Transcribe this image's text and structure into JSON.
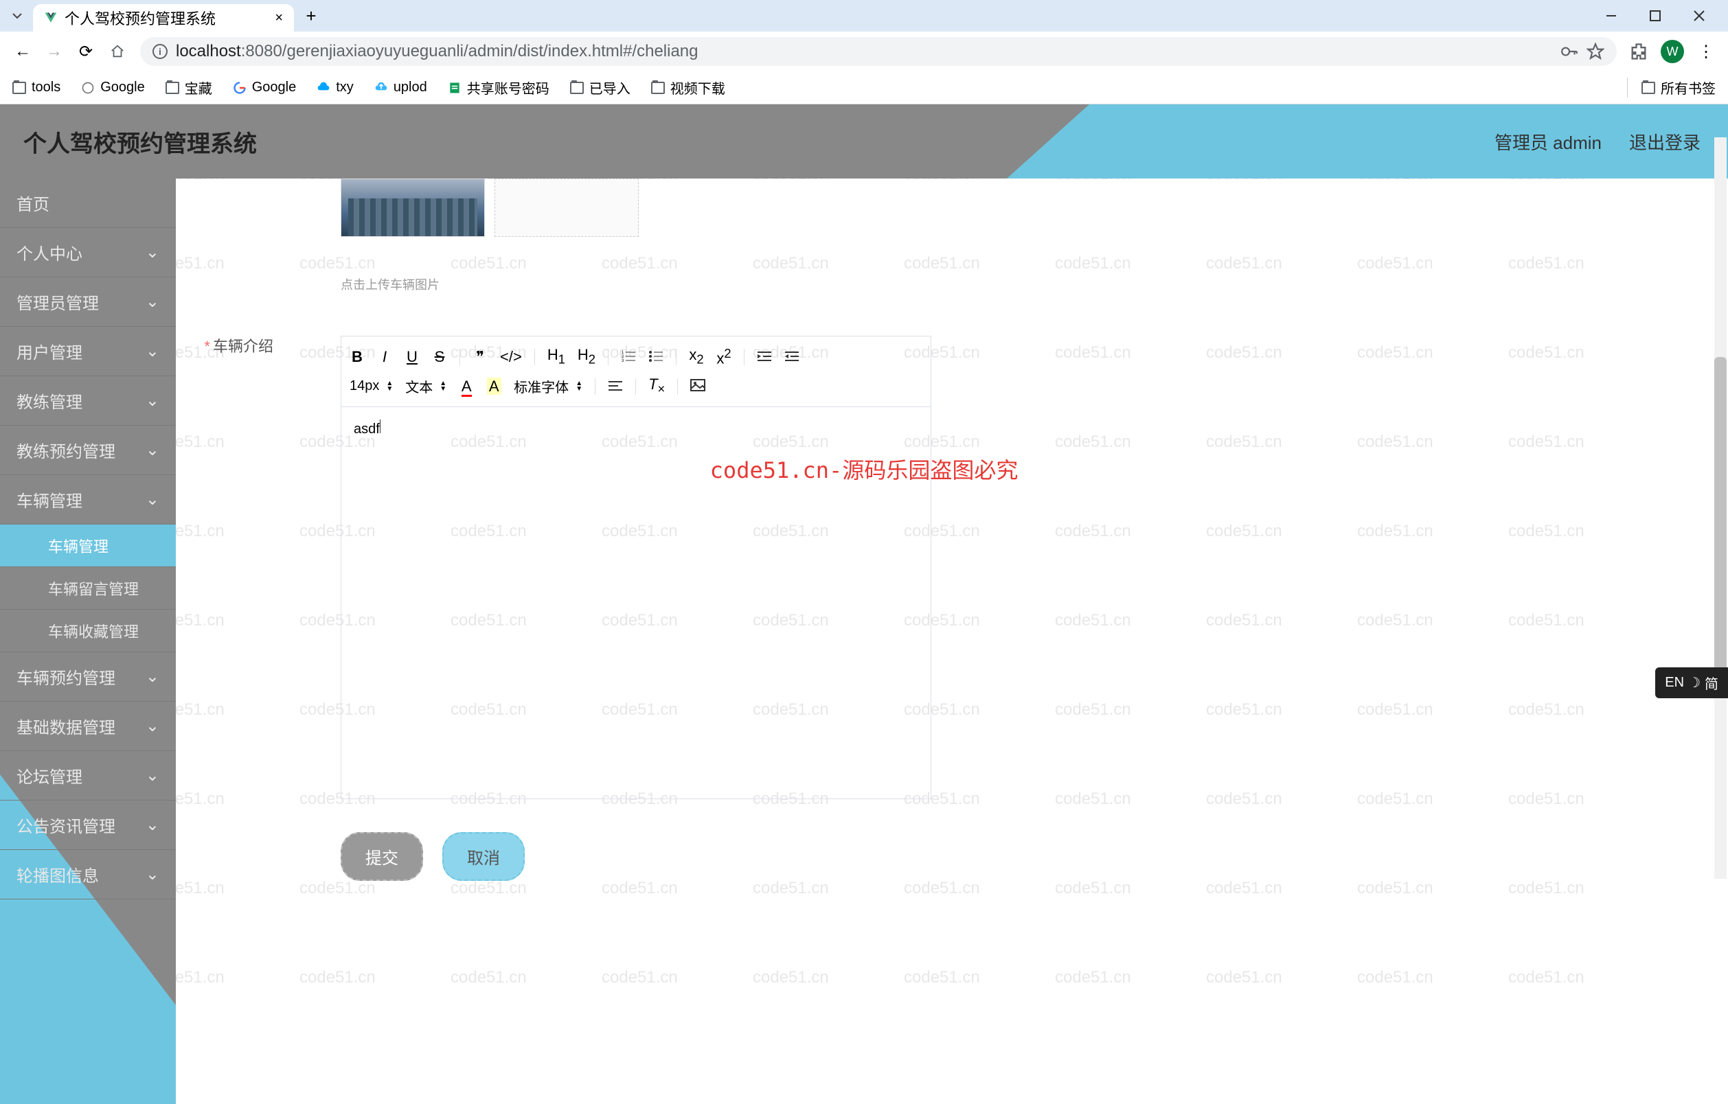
{
  "browser": {
    "tab_title": "个人驾校预约管理系统",
    "new_tab": "+",
    "url_host": "localhost",
    "url_port": ":8080",
    "url_path": "/gerenjiaxiaoyuyueguanli/admin/dist/index.html#/cheliang",
    "avatar_letter": "W"
  },
  "bookmarks": {
    "items": [
      {
        "label": "tools",
        "icon": "folder"
      },
      {
        "label": "Google",
        "icon": "google"
      },
      {
        "label": "宝藏",
        "icon": "folder"
      },
      {
        "label": "Google",
        "icon": "google-g"
      },
      {
        "label": "txy",
        "icon": "cloud"
      },
      {
        "label": "uplod",
        "icon": "upload"
      },
      {
        "label": "共享账号密码",
        "icon": "sheet"
      },
      {
        "label": "已导入",
        "icon": "folder"
      },
      {
        "label": "视频下载",
        "icon": "folder"
      }
    ],
    "all_bookmarks": "所有书签"
  },
  "header": {
    "title": "个人驾校预约管理系统",
    "admin_label": "管理员 admin",
    "logout": "退出登录"
  },
  "sidebar": {
    "items": [
      {
        "label": "首页",
        "expandable": false
      },
      {
        "label": "个人中心",
        "expandable": true
      },
      {
        "label": "管理员管理",
        "expandable": true
      },
      {
        "label": "用户管理",
        "expandable": true
      },
      {
        "label": "教练管理",
        "expandable": true
      },
      {
        "label": "教练预约管理",
        "expandable": true
      },
      {
        "label": "车辆管理",
        "expandable": true
      },
      {
        "label": "车辆管理",
        "sub": true,
        "active": true
      },
      {
        "label": "车辆留言管理",
        "sub": true
      },
      {
        "label": "车辆收藏管理",
        "sub": true
      },
      {
        "label": "车辆预约管理",
        "expandable": true
      },
      {
        "label": "基础数据管理",
        "expandable": true
      },
      {
        "label": "论坛管理",
        "expandable": true
      },
      {
        "label": "公告资讯管理",
        "expandable": true
      },
      {
        "label": "轮播图信息",
        "expandable": true
      }
    ]
  },
  "form": {
    "upload_hint": "点击上传车辆图片",
    "intro_label": "车辆介绍",
    "editor_content": "asdf",
    "font_size": "14px",
    "text_style": "文本",
    "font_family": "标准字体",
    "submit": "提交",
    "cancel": "取消"
  },
  "watermark_text": "code51.cn",
  "center_warning": "code51.cn-源码乐园盗图必究",
  "ime": {
    "label": "EN",
    "mode": "简"
  }
}
